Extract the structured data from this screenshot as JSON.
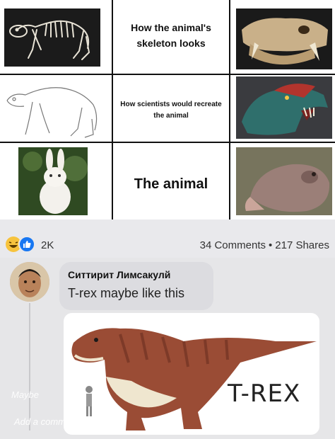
{
  "meme": {
    "row1_caption": "How the animal's skeleton looks",
    "row2_caption": "How scientists would recreate the animal",
    "row3_caption": "The animal"
  },
  "post": {
    "reaction_count": "2K",
    "comments": "34 Comments",
    "separator": "•",
    "shares": "217 Shares"
  },
  "comment": {
    "author": "Ситтирит Лимсакулй",
    "text": "T-rex maybe like this",
    "attachment_label": "T-REX"
  },
  "composer": {
    "hint": "Maybe",
    "placeholder": "Add a comment..."
  },
  "icons": [
    "haha-icon",
    "like-icon"
  ],
  "colors": {
    "like_blue": "#1877f2",
    "haha_yellow": "#f7c33d",
    "bubble_gray": "#dcdce0"
  }
}
